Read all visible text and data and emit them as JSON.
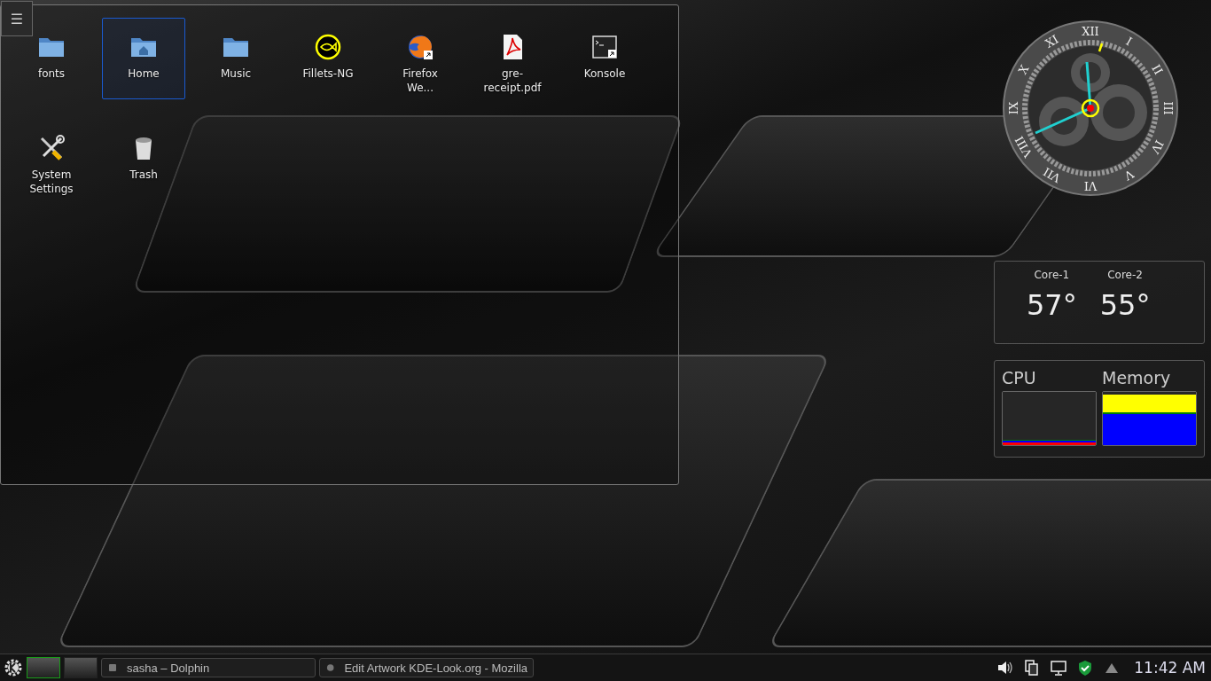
{
  "desktop": {
    "menu_icon": "☰",
    "icons": [
      {
        "label": "fonts",
        "kind": "folder",
        "selected": false
      },
      {
        "label": "Home",
        "kind": "home",
        "selected": true
      },
      {
        "label": "Music",
        "kind": "folder",
        "selected": false
      },
      {
        "label": "Fillets-NG",
        "kind": "fish",
        "selected": false
      },
      {
        "label": "Firefox We...",
        "kind": "browser",
        "selected": false
      },
      {
        "label": "gre-receipt.pdf",
        "kind": "pdf",
        "selected": false
      },
      {
        "label": "Konsole",
        "kind": "terminal",
        "selected": false
      },
      {
        "label": "System Settings",
        "kind": "tools",
        "selected": false
      },
      {
        "label": "Trash",
        "kind": "trash",
        "selected": false
      }
    ]
  },
  "clock": {
    "numerals": [
      "XII",
      "I",
      "II",
      "III",
      "IV",
      "V",
      "VI",
      "VII",
      "VIII",
      "IX",
      "X",
      "XI"
    ]
  },
  "temperature": {
    "cores": [
      {
        "label": "Core-1",
        "value": "57°"
      },
      {
        "label": "Core-2",
        "value": "55°"
      }
    ]
  },
  "system_monitor": {
    "panels": [
      {
        "label": "CPU",
        "kind": "cpu"
      },
      {
        "label": "Memory",
        "kind": "memory"
      }
    ]
  },
  "taskbar": {
    "desktops": [
      {
        "selected": true
      },
      {
        "selected": false
      }
    ],
    "tasks": [
      {
        "label": "sasha – Dolphin",
        "kind": "files"
      },
      {
        "label": "Edit  Artwork KDE-Look.org - Mozilla",
        "kind": "browser"
      }
    ],
    "time": "11:42 AM"
  }
}
